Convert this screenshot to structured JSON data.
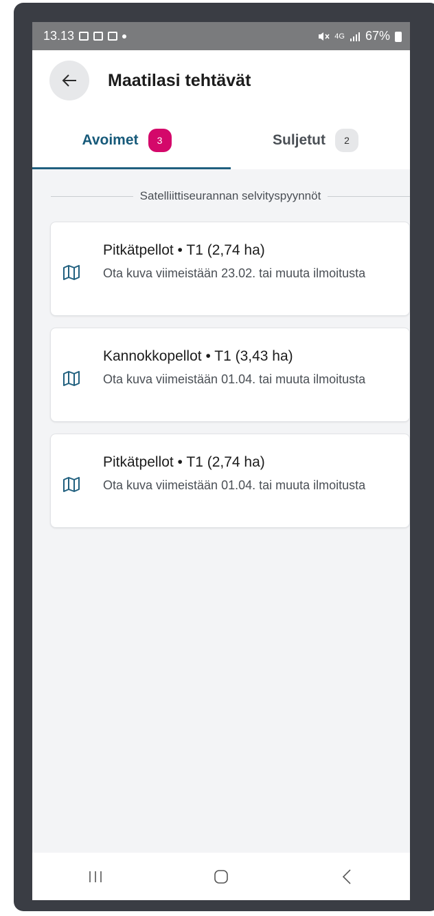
{
  "status_bar": {
    "time": "13.13",
    "network": "4G",
    "battery": "67%"
  },
  "header": {
    "title": "Maatilasi tehtävät",
    "back_icon": "arrow-left-icon"
  },
  "tabs": [
    {
      "label": "Avoimet",
      "count": "3",
      "active": true
    },
    {
      "label": "Suljetut",
      "count": "2",
      "active": false
    }
  ],
  "section": {
    "title": "Satelliittiseurannan selvityspyynnöt"
  },
  "tasks": [
    {
      "title": "Pitkätpellot • T1 (2,74 ha)",
      "description": "Ota kuva viimeistään 23.02. tai muuta ilmoitusta",
      "icon": "map-icon"
    },
    {
      "title": "Kannokkopellot • T1 (3,43 ha)",
      "description": "Ota kuva viimeistään 01.04. tai muuta ilmoitusta",
      "icon": "map-icon"
    },
    {
      "title": "Pitkätpellot • T1 (2,74 ha)",
      "description": "Ota kuva viimeistään 01.04. tai muuta ilmoitusta",
      "icon": "map-icon"
    }
  ],
  "colors": {
    "accent": "#175a7a",
    "badge_active": "#d4086a",
    "background": "#f3f4f6"
  }
}
